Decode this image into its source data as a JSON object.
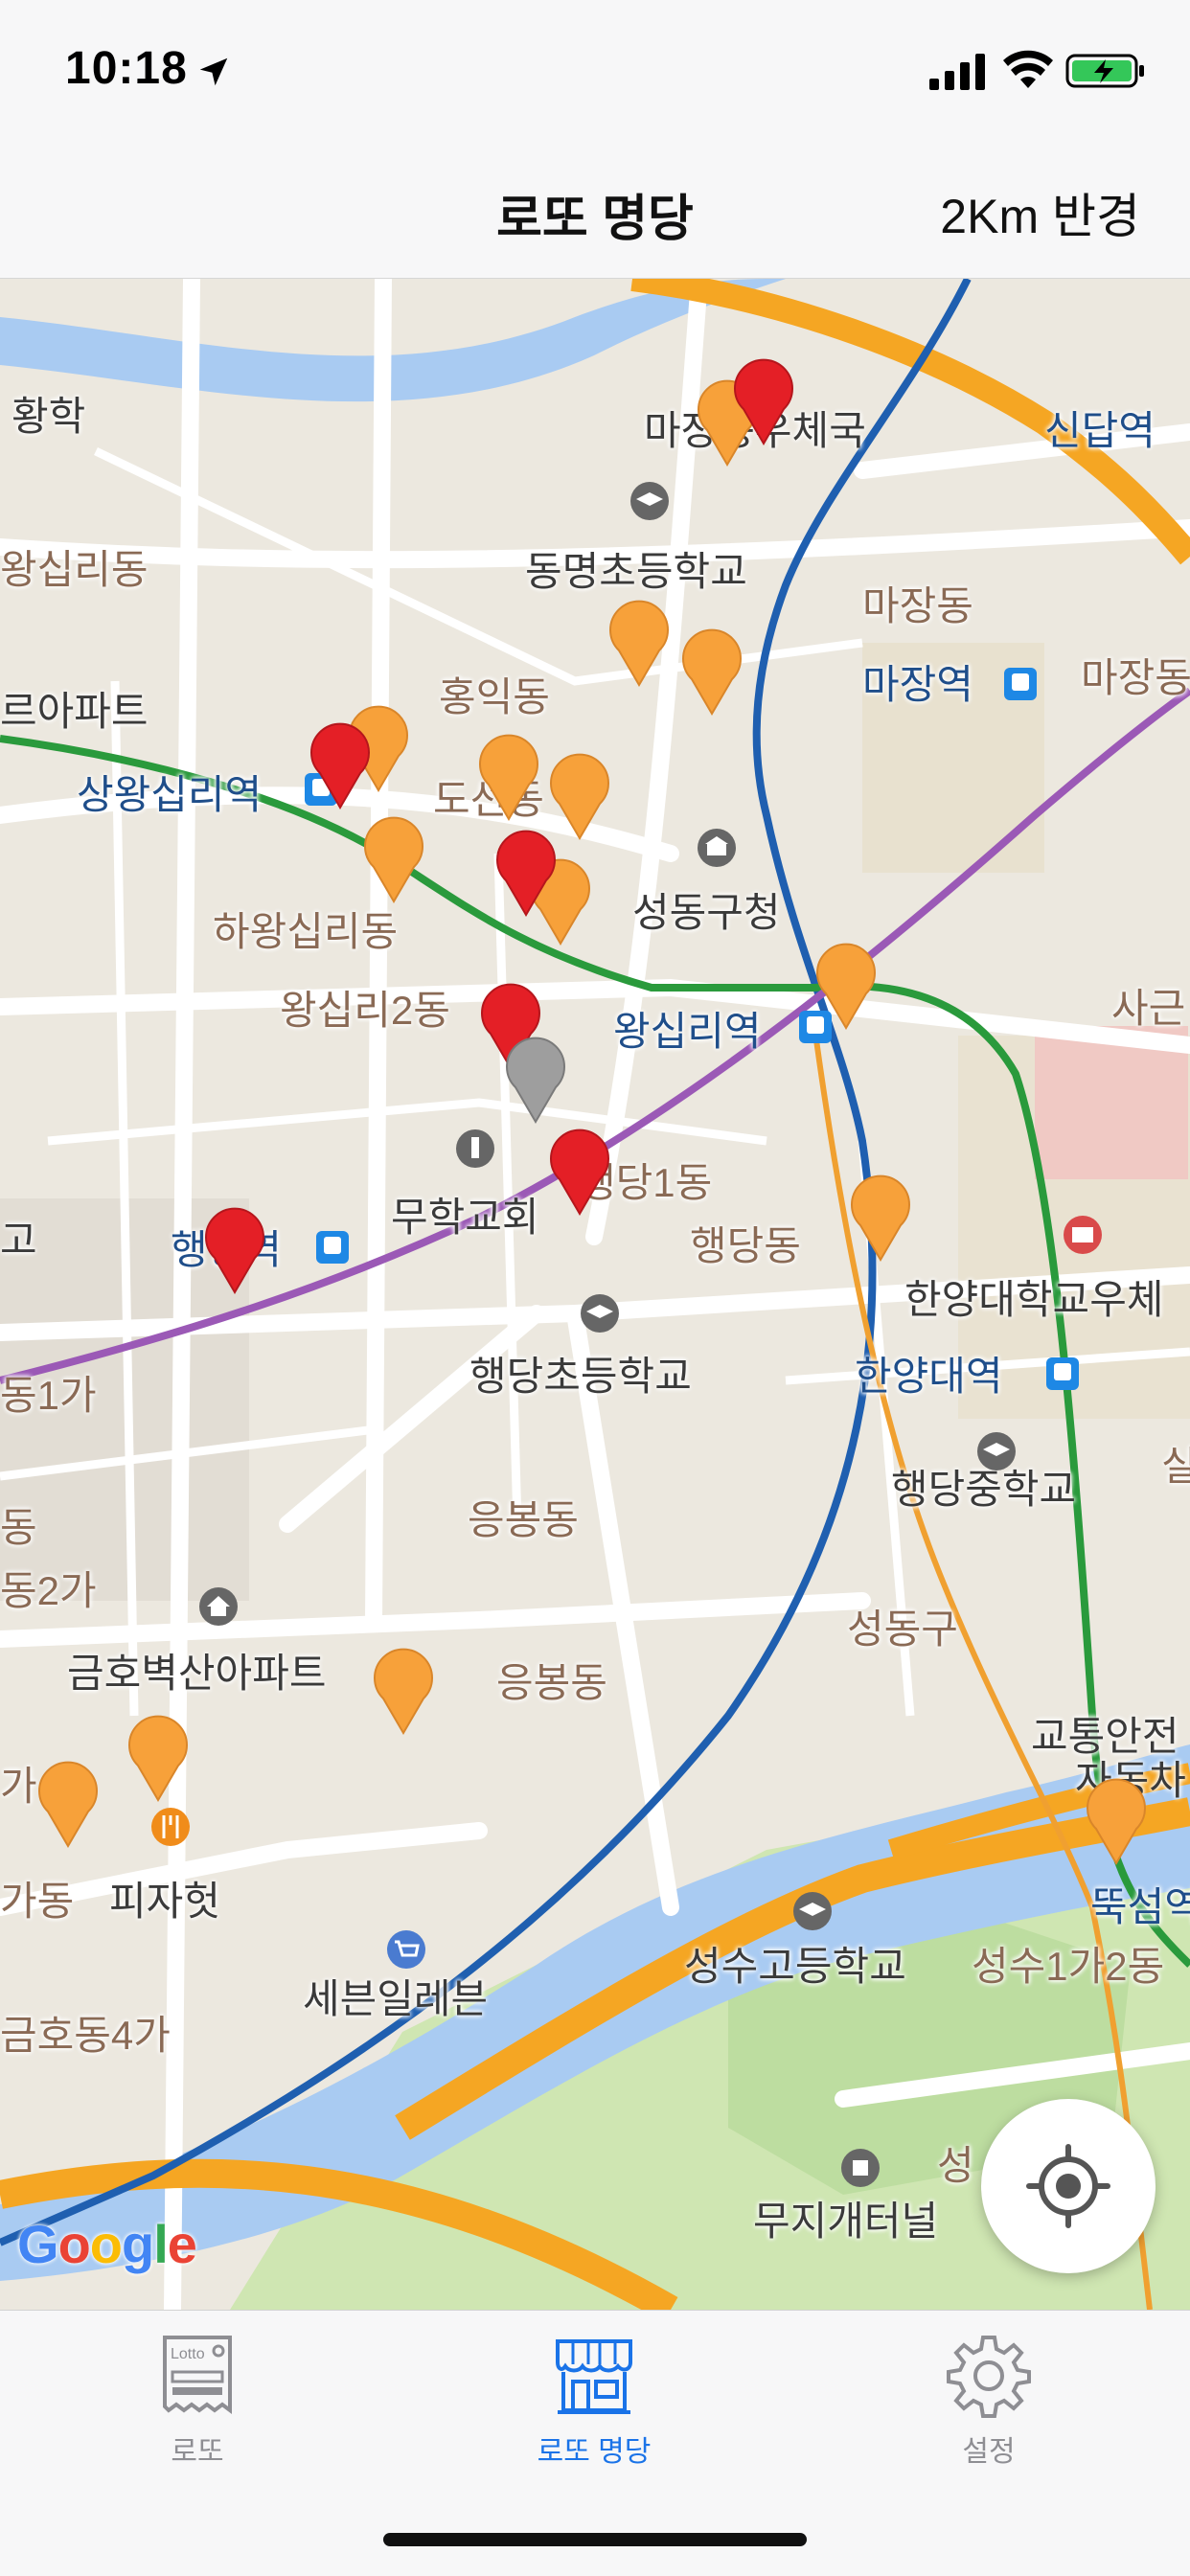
{
  "status": {
    "time": "10:18"
  },
  "nav": {
    "title": "로또 명당",
    "radius": "2Km 반경"
  },
  "map": {
    "labels": [
      {
        "text": "황학"
      },
      {
        "text": "마장동우체국"
      },
      {
        "text": "신답역"
      },
      {
        "text": "왕십리동"
      },
      {
        "text": "동명초등학교"
      },
      {
        "text": "마장동"
      },
      {
        "text": "르아파트"
      },
      {
        "text": "홍익동"
      },
      {
        "text": "마장역"
      },
      {
        "text": "마장동"
      },
      {
        "text": "상왕십리역"
      },
      {
        "text": "도선동"
      },
      {
        "text": "하왕십리동"
      },
      {
        "text": "성동구청"
      },
      {
        "text": "왕십리2동"
      },
      {
        "text": "왕십리역"
      },
      {
        "text": "사근"
      },
      {
        "text": "행당1동"
      },
      {
        "text": "무학교회"
      },
      {
        "text": "행당역"
      },
      {
        "text": "행당동"
      },
      {
        "text": "한양대학교우체"
      },
      {
        "text": "동1가"
      },
      {
        "text": "행당초등학교"
      },
      {
        "text": "한양대역"
      },
      {
        "text": "행당중학교"
      },
      {
        "text": "응봉동"
      },
      {
        "text": "동2가"
      },
      {
        "text": "성동구"
      },
      {
        "text": "금호벽산아파트"
      },
      {
        "text": "응봉동"
      },
      {
        "text": "교통안전"
      },
      {
        "text": "자동차"
      },
      {
        "text": "가동"
      },
      {
        "text": "피자헛"
      },
      {
        "text": "뚝섬역"
      },
      {
        "text": "세븐일레븐"
      },
      {
        "text": "성수고등학교"
      },
      {
        "text": "성수1가2동"
      },
      {
        "text": "금호동4가"
      },
      {
        "text": "무지개터널"
      },
      {
        "text": "성"
      },
      {
        "text": "고"
      },
      {
        "text": "실"
      },
      {
        "text": "동"
      },
      {
        "text": "가"
      }
    ],
    "google": "Google"
  },
  "tabs": [
    {
      "label": "로또",
      "icon": "lotto-ticket-icon"
    },
    {
      "label": "로또 명당",
      "icon": "store-icon"
    },
    {
      "label": "설정",
      "icon": "gear-icon"
    }
  ],
  "colors": {
    "accent": "#1a73e8",
    "pin_red": "#e41f26",
    "pin_orange": "#f7a13a",
    "pin_gray": "#9e9e9e"
  }
}
